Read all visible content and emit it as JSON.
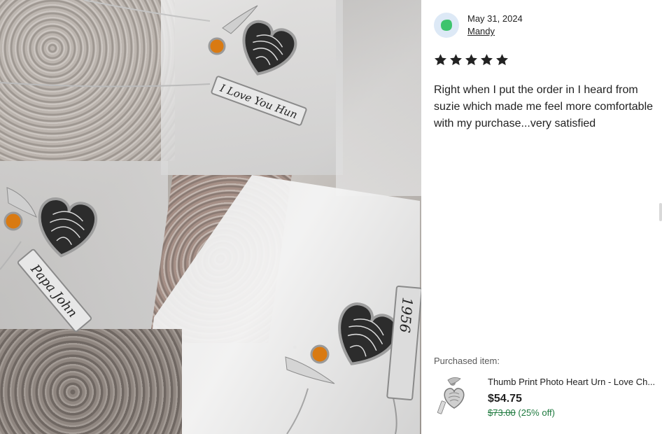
{
  "review": {
    "date": "May 31, 2024",
    "reviewer_name": "Mandy",
    "rating": 5,
    "rating_max": 5,
    "text": "Right when I put the order in I heard from suzie which made me feel more comfortable with my purchase...very satisfied"
  },
  "photo": {
    "engravings": [
      "I Love You Hun",
      "Papa John",
      "1956"
    ]
  },
  "purchased": {
    "label": "Purchased item:",
    "title": "Thumb Print Photo Heart Urn - Love Ch...",
    "price": "$54.75",
    "original_price": "$73.00",
    "discount": "(25% off)"
  },
  "colors": {
    "avatar_bg": "#dde9f6",
    "avatar_leaf": "#3ec46d",
    "star": "#222222",
    "discount_green": "#1f7a3f"
  },
  "icons": {
    "avatar": "leaf-avatar-icon",
    "star": "star-icon"
  }
}
